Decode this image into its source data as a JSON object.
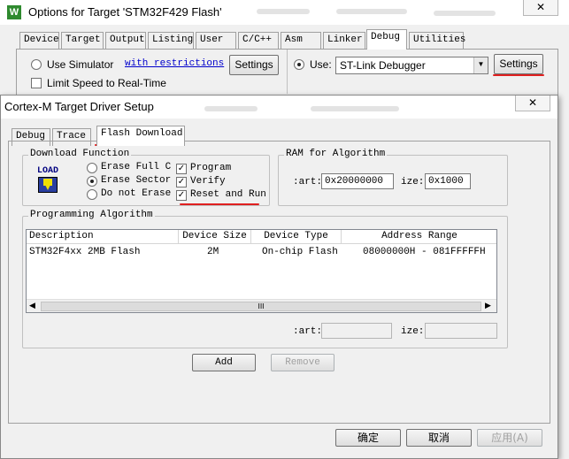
{
  "back_window": {
    "title": "Options for Target 'STM32F429 Flash'",
    "app_icon": "W",
    "close_glyph": "✕",
    "tabs": [
      "Device",
      "Target",
      "Output",
      "Listing",
      "User",
      "C/C++",
      "Asm",
      "Linker",
      "Debug",
      "Utilities"
    ],
    "active_tab": "Debug",
    "use_simulator_label": "Use Simulator",
    "with_restrictions_link": "with restrictions",
    "left_settings_label": "Settings",
    "limit_speed_label": "Limit Speed to Real-Time",
    "use_label": "Use:",
    "debugger_select": "ST-Link Debugger",
    "right_settings_label": "Settings"
  },
  "dialog": {
    "title": "Cortex-M Target Driver Setup",
    "close_glyph": "✕",
    "tabs": [
      "Debug",
      "Trace",
      "Flash Download"
    ],
    "active_tab": "Flash Download",
    "download_function": {
      "group_title": "Download Function",
      "load_icon_text": "LOAD",
      "erase_full": "Erase Full C",
      "erase_sector": "Erase Sector",
      "do_not_erase": "Do not Erase",
      "program": "Program",
      "verify": "Verify",
      "reset_and_run": "Reset and Run"
    },
    "ram": {
      "group_title": "RAM for Algorithm",
      "start_label": ":art:",
      "start_value": "0x20000000",
      "size_label": "ize:",
      "size_value": "0x1000"
    },
    "algorithm": {
      "group_title": "Programming Algorithm",
      "columns": [
        "Description",
        "Device Size",
        "Device Type",
        "Address Range"
      ],
      "rows": [
        {
          "description": "STM32F4xx 2MB Flash",
          "size": "2M",
          "type": "On-chip Flash",
          "range": "08000000H - 081FFFFFH"
        }
      ],
      "scroll_thumb": "III",
      "start_label": ":art:",
      "size_label": "ize:"
    },
    "add_label": "Add",
    "remove_label": "Remove"
  },
  "footer": {
    "ok_label": "确定",
    "cancel_label": "取消",
    "apply_label": "应用(A)"
  },
  "colors": {
    "annotation": "#e02020",
    "link": "#0000cc"
  }
}
